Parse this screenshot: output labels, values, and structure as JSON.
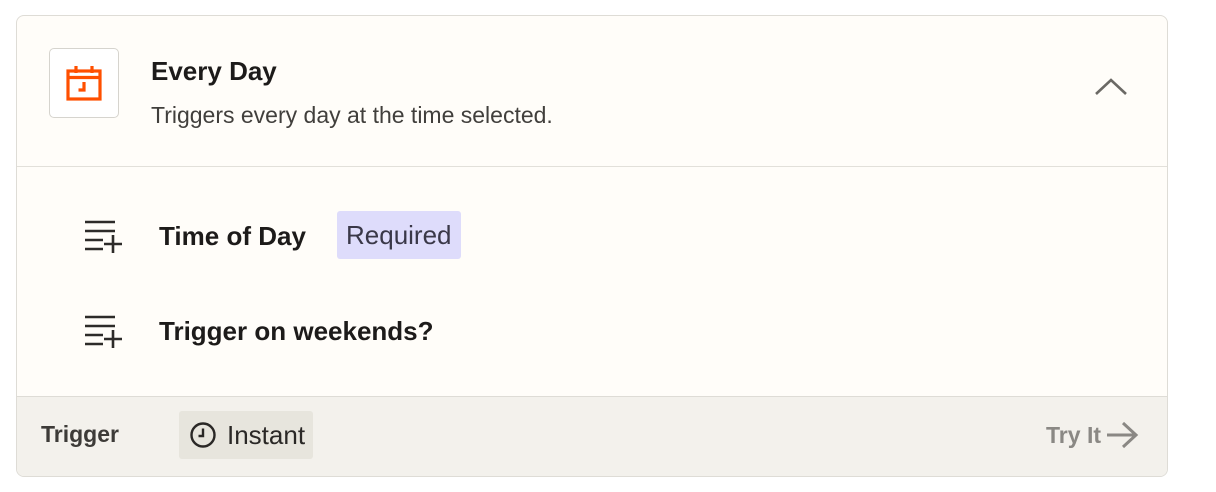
{
  "trigger_card": {
    "app_icon": "calendar-clock-icon",
    "title": "Every Day",
    "description": "Triggers every day at the time selected.",
    "collapse_icon": "chevron-up-icon",
    "accent_color": "#ff4f00"
  },
  "fields": [
    {
      "label": "Time of Day",
      "required_label": "Required",
      "icon": "add-field-icon"
    },
    {
      "label": "Trigger on weekends?",
      "icon": "add-field-icon"
    }
  ],
  "footer": {
    "type_label": "Trigger",
    "mode_label": "Instant",
    "mode_icon": "clock-icon",
    "try_label": "Try It",
    "try_icon": "arrow-right-icon"
  }
}
